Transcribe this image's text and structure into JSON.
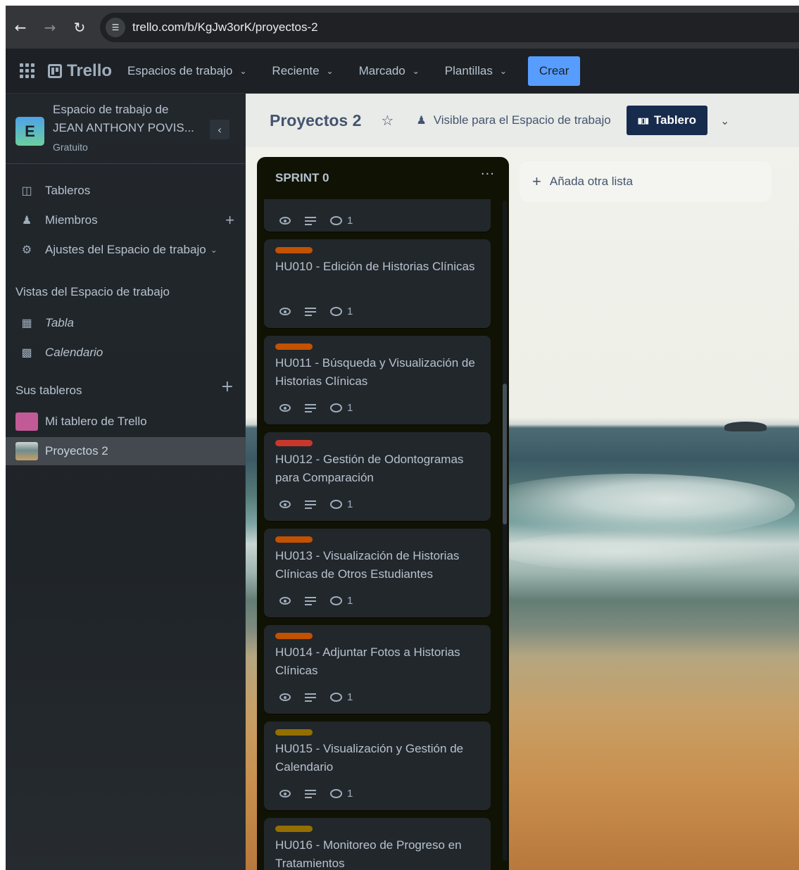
{
  "browser": {
    "url": "trello.com/b/KgJw3orK/proyectos-2"
  },
  "header": {
    "logo": "Trello",
    "nav": [
      "Espacios de trabajo",
      "Reciente",
      "Marcado",
      "Plantillas"
    ],
    "create_label": "Crear"
  },
  "sidebar": {
    "workspace_initial": "E",
    "workspace_line1": "Espacio de trabajo de",
    "workspace_line2": "JEAN ANTHONY POVIS...",
    "workspace_plan": "Gratuito",
    "items": {
      "boards": "Tableros",
      "members": "Miembros",
      "settings": "Ajustes del Espacio de trabajo"
    },
    "views_heading": "Vistas del Espacio de trabajo",
    "views": [
      "Tabla",
      "Calendario"
    ],
    "your_boards_heading": "Sus tableros",
    "boards": [
      {
        "name": "Mi tablero de Trello",
        "color": "#c25a97"
      },
      {
        "name": "Proyectos 2"
      }
    ]
  },
  "board": {
    "title": "Proyectos 2",
    "visibility": "Visible para el Espacio de trabajo",
    "view_label": "Tablero",
    "add_list_label": "Añada otra lista"
  },
  "list": {
    "title": "SPRINT 0",
    "menu": "···",
    "cards": [
      {
        "title": "",
        "label_color": "",
        "comments": "1"
      },
      {
        "title": "HU010 - Edición de Historias Clínicas",
        "label_color": "#c25100",
        "comments": "1"
      },
      {
        "title": "HU011 - Búsqueda y Visualización de Historias Clínicas",
        "label_color": "#c25100",
        "comments": "1"
      },
      {
        "title": "HU012 - Gestión de Odontogramas para Comparación",
        "label_color": "#c9372c",
        "comments": "1"
      },
      {
        "title": "HU013 - Visualización de Historias Clínicas de Otros Estudiantes",
        "label_color": "#c25100",
        "comments": "1"
      },
      {
        "title": "HU014 - Adjuntar Fotos a Historias Clínicas",
        "label_color": "#c25100",
        "comments": "1"
      },
      {
        "title": "HU015 - Visualización y Gestión de Calendario",
        "label_color": "#946f00",
        "comments": "1"
      },
      {
        "title": "HU016 - Monitoreo de Progreso en Tratamientos",
        "label_color": "#946f00",
        "comments": ""
      }
    ]
  }
}
